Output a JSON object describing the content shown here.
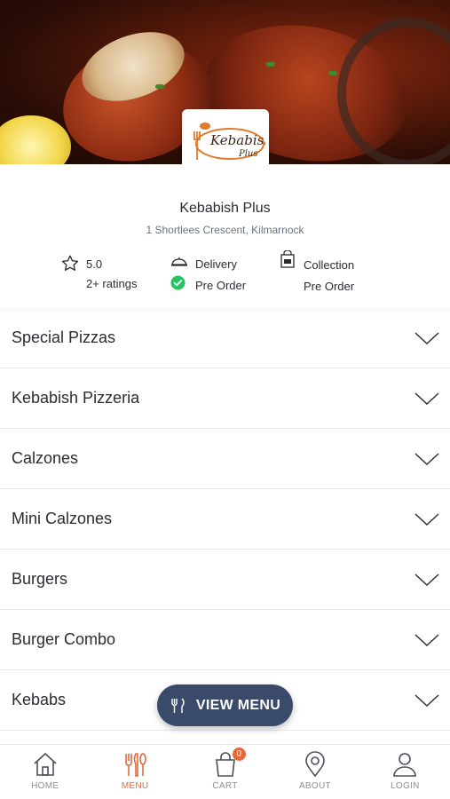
{
  "store": {
    "logo_text_line1": "Kebabish",
    "logo_text_line2": "Plus",
    "name": "Kebabish Plus",
    "address": "1 Shortlees Crescent, Kilmarnock",
    "rating_value": "5.0",
    "rating_count": "2+ ratings",
    "delivery_label": "Delivery",
    "delivery_preorder": "Pre Order",
    "collection_label": "Collection",
    "collection_preorder": "Pre Order"
  },
  "categories": [
    {
      "label": "Special Pizzas"
    },
    {
      "label": "Kebabish Pizzeria"
    },
    {
      "label": "Calzones"
    },
    {
      "label": "Mini Calzones"
    },
    {
      "label": "Burgers"
    },
    {
      "label": "Burger Combo"
    },
    {
      "label": "Kebabs"
    }
  ],
  "fab": {
    "label": "VIEW MENU"
  },
  "tabs": [
    {
      "label": "HOME",
      "icon": "home-icon"
    },
    {
      "label": "MENU",
      "icon": "fork-knife-icon",
      "active": true
    },
    {
      "label": "CART",
      "icon": "bag-icon",
      "badge": "0"
    },
    {
      "label": "ABOUT",
      "icon": "location-pin-icon"
    },
    {
      "label": "LOGIN",
      "icon": "user-icon"
    }
  ],
  "colors": {
    "accent": "#e06a3c",
    "fab": "#3a4a6b",
    "success": "#22c55e"
  }
}
